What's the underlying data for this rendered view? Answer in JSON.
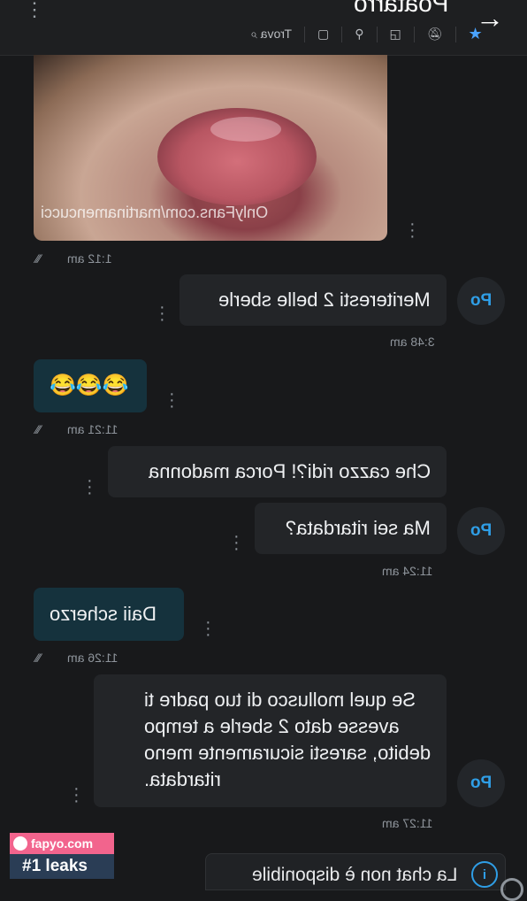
{
  "header": {
    "title": "Poatarro",
    "search_label": "Trova",
    "back_icon": "arrow-right-icon"
  },
  "messages": [
    {
      "id": "m1",
      "kind": "image",
      "watermark": "OnlyFans.com/martinamencucci",
      "time": "1:12 am"
    },
    {
      "id": "m2",
      "kind": "outgoing",
      "text": "Meriteresti 2 belle sberle",
      "time": "3:48 am",
      "avatar": "Po"
    },
    {
      "id": "m3",
      "kind": "incoming",
      "text": "😂😂😂",
      "time": "11:21 am"
    },
    {
      "id": "m4",
      "kind": "outgoing",
      "text": "Che cazzo ridi?! Porca madonna"
    },
    {
      "id": "m5",
      "kind": "outgoing",
      "text": "Ma sei ritardata?",
      "time": "11:24 am",
      "avatar": "Po"
    },
    {
      "id": "m6",
      "kind": "incoming",
      "text": "Daii scherzo",
      "time": "11:26 am"
    },
    {
      "id": "m7",
      "kind": "outgoing",
      "text": "Se quel mollusco di tuo padre ti\navesse dato 2 sberle a tempo\ndebito, saresti sicuramente meno\nritardata.",
      "time": "11:27 am",
      "avatar": "Po"
    }
  ],
  "footer": {
    "placeholder": "La chat non è disponibile"
  },
  "badge": {
    "top": "fapyo.com",
    "bottom": "#1 leaks"
  },
  "colors": {
    "background": "#18191b",
    "outgoing_bubble": "#232528",
    "incoming_bubble": "#15323d",
    "accent": "#2f9ee6"
  }
}
